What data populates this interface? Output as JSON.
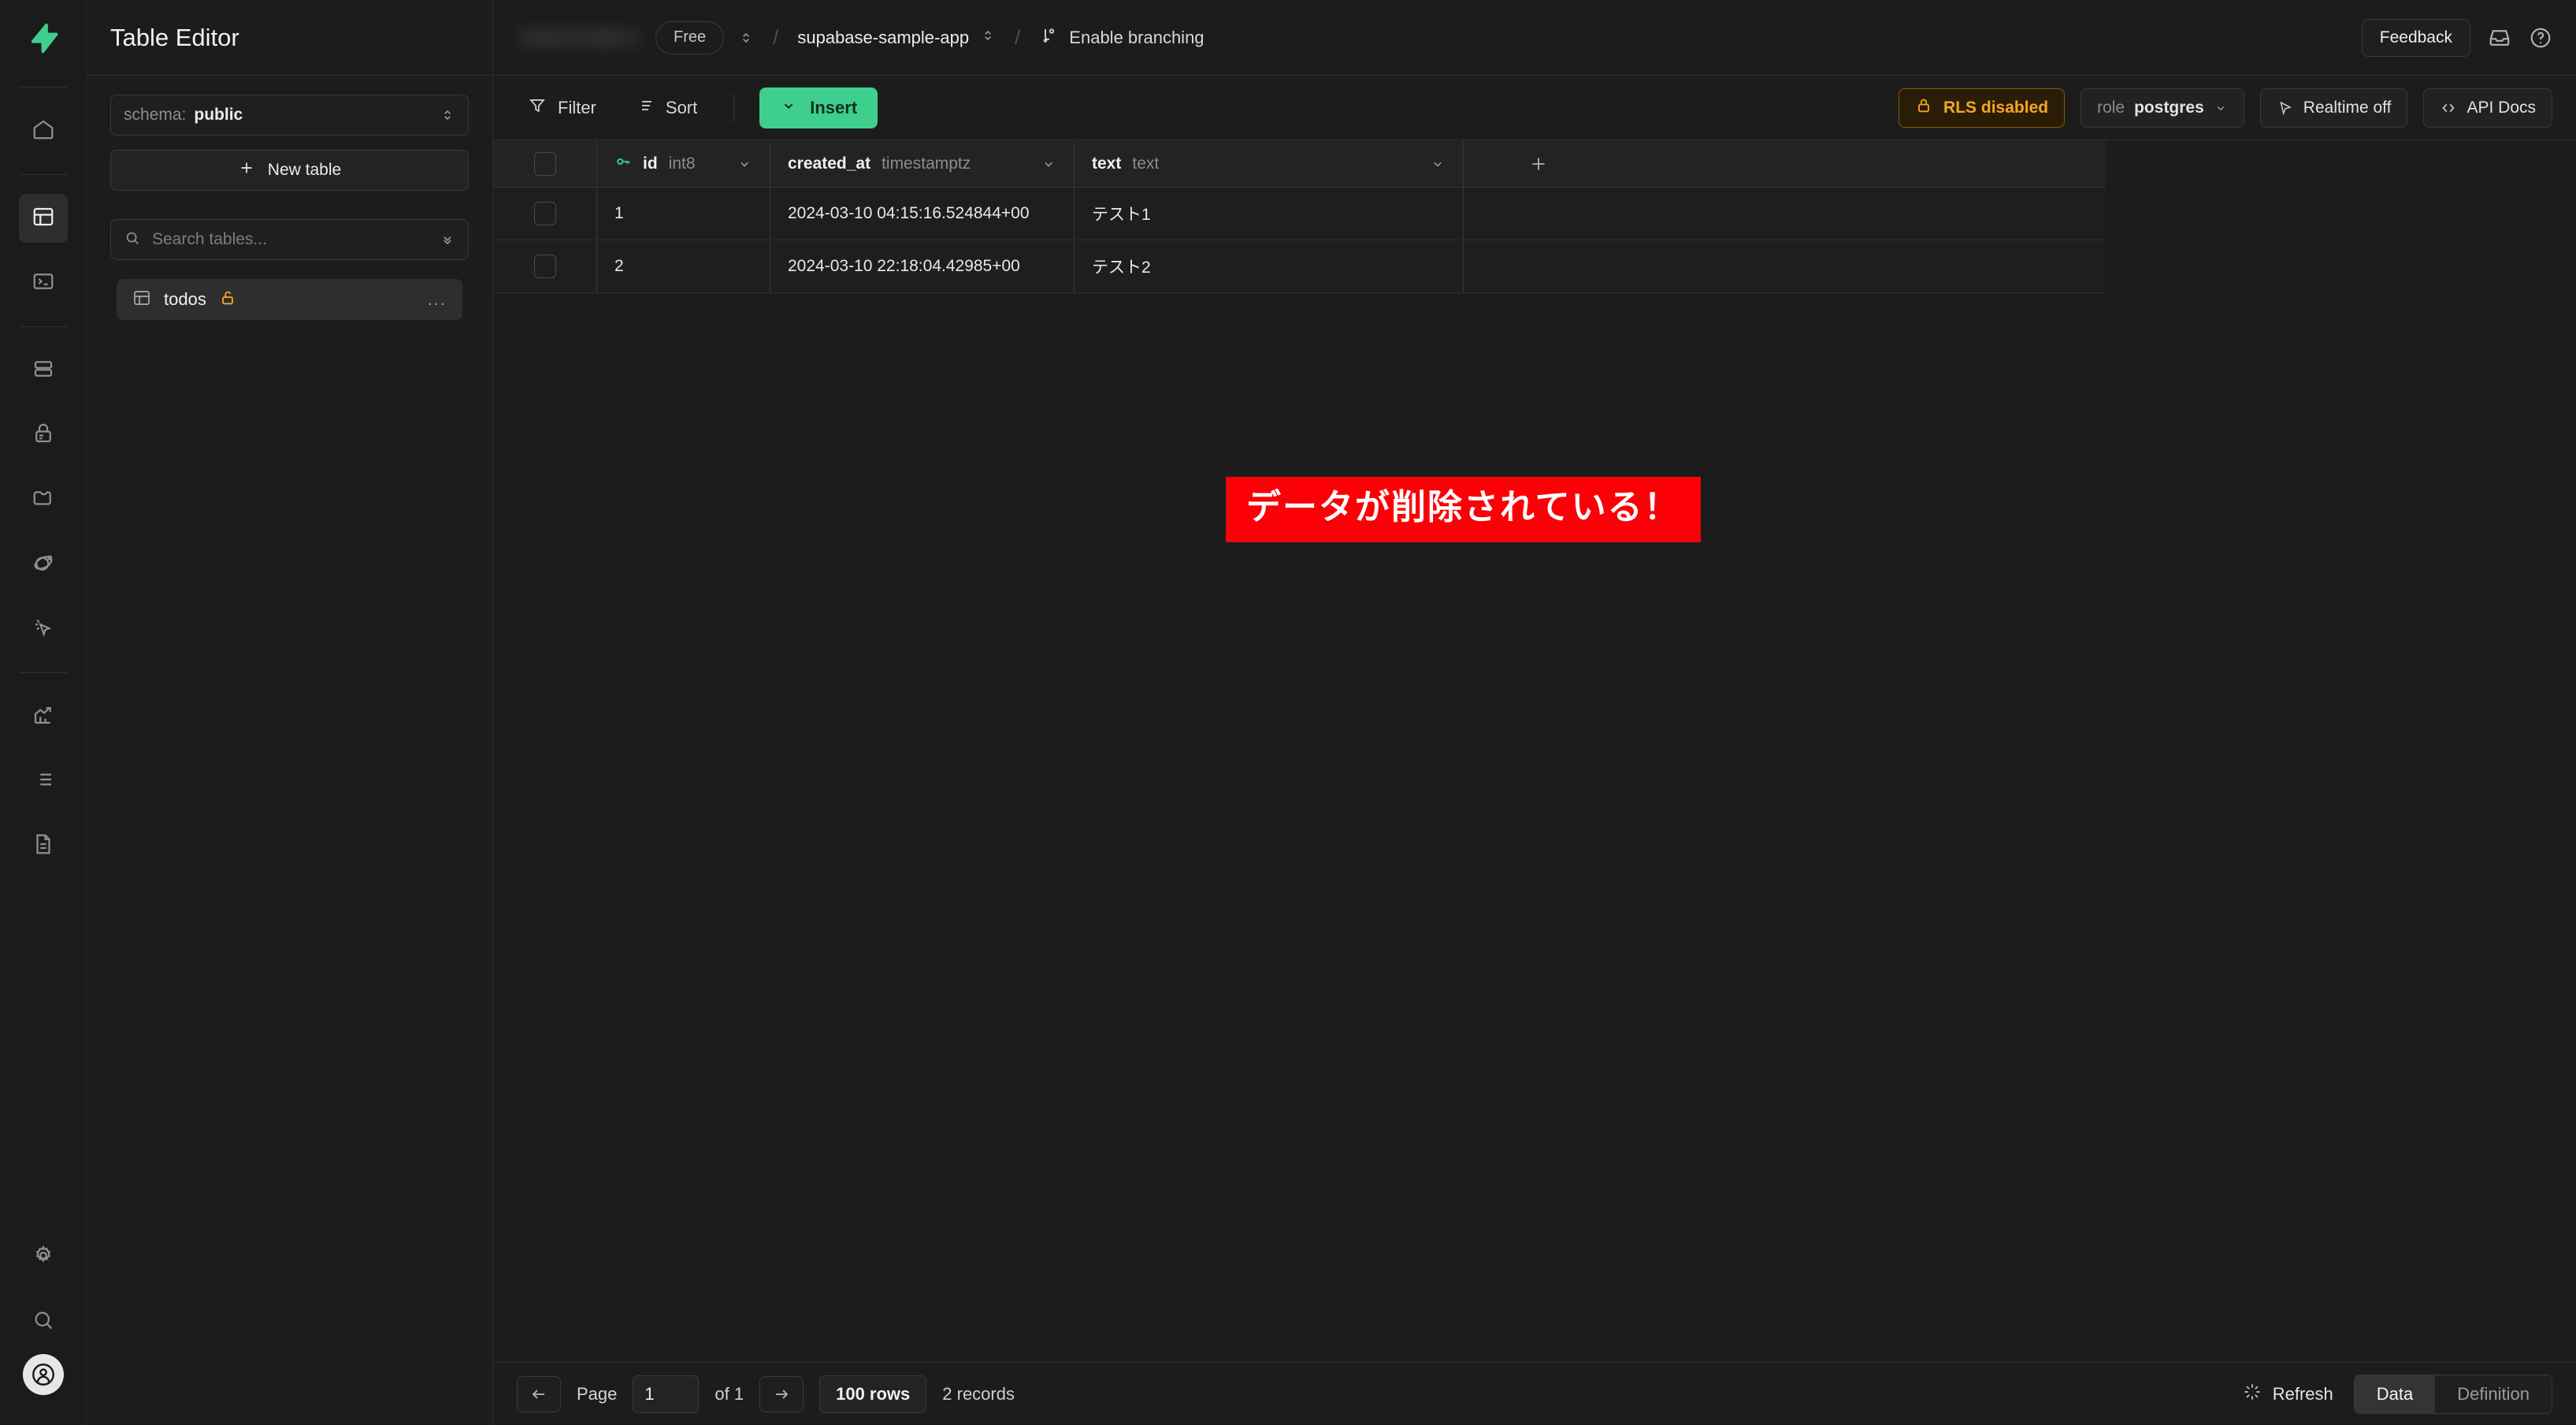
{
  "brand": {
    "accent": "#3ecf8e",
    "warning": "#f5a623",
    "annotation_bg": "#fb0007"
  },
  "rail": {
    "logo_name": "supabase-logo",
    "items": [
      {
        "name": "home",
        "icon": "home-icon"
      },
      {
        "name": "table-editor",
        "icon": "table-icon",
        "active": true
      },
      {
        "name": "sql-editor",
        "icon": "terminal-icon"
      },
      {
        "name": "database",
        "icon": "database-icon"
      },
      {
        "name": "authentication",
        "icon": "lock-icon"
      },
      {
        "name": "storage",
        "icon": "folder-icon"
      },
      {
        "name": "edge-functions",
        "icon": "orbit-icon"
      },
      {
        "name": "realtime",
        "icon": "cursor-click-icon"
      },
      {
        "name": "reports",
        "icon": "bar-chart-icon"
      },
      {
        "name": "logs",
        "icon": "list-icon"
      },
      {
        "name": "api-docs",
        "icon": "document-icon"
      },
      {
        "name": "settings",
        "icon": "gear-icon"
      },
      {
        "name": "search",
        "icon": "search-icon"
      }
    ],
    "avatar_icon": "user-avatar-icon"
  },
  "panel": {
    "title": "Table Editor",
    "schema_label": "schema:",
    "schema_value": "public",
    "new_table_label": "New table",
    "search_placeholder": "Search tables...",
    "search_value": "",
    "tables": [
      {
        "name": "todos",
        "rls_icon": "unlocked-padlock-icon",
        "menu": "..."
      }
    ]
  },
  "topbar": {
    "org_name": "",
    "plan": "Free",
    "project": "supabase-sample-app",
    "branching_label": "Enable branching",
    "feedback_label": "Feedback",
    "inbox_icon": "inbox-icon",
    "help_icon": "help-circle-icon"
  },
  "toolbar": {
    "filter_label": "Filter",
    "sort_label": "Sort",
    "insert_label": "Insert",
    "rls_label": "RLS disabled",
    "role_label": "role",
    "role_value": "postgres",
    "realtime_label": "Realtime off",
    "api_docs_label": "API Docs"
  },
  "grid": {
    "columns": [
      {
        "name": "id",
        "type": "int8",
        "primary_key": true
      },
      {
        "name": "created_at",
        "type": "timestamptz",
        "primary_key": false
      },
      {
        "name": "text",
        "type": "text",
        "primary_key": false
      }
    ],
    "add_column_label": "+",
    "rows": [
      {
        "id": "1",
        "created_at": "2024-03-10 04:15:16.524844+00",
        "text": "テスト1"
      },
      {
        "id": "2",
        "created_at": "2024-03-10 22:18:04.42985+00",
        "text": "テスト2"
      }
    ]
  },
  "annotation": {
    "text": "データが削除されている！"
  },
  "footer": {
    "page_label": "Page",
    "page_value": "1",
    "of_label": "of 1",
    "rows_label": "100 rows",
    "records_label": "2 records",
    "refresh_label": "Refresh",
    "tab_data": "Data",
    "tab_definition": "Definition"
  }
}
